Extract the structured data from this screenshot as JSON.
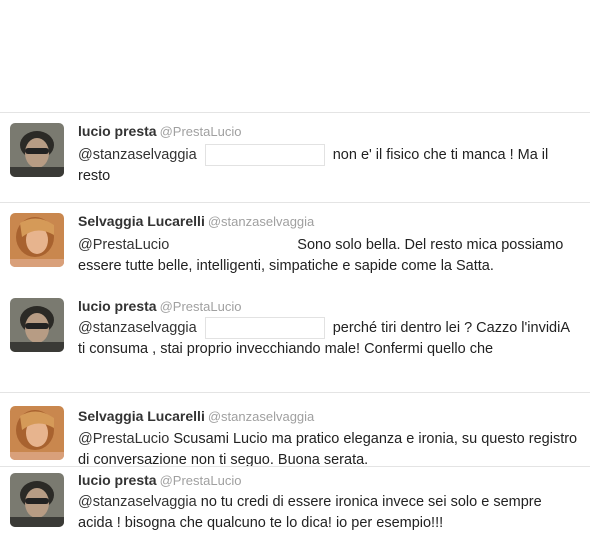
{
  "tweets": [
    {
      "name": "lucio presta",
      "handle": "@PrestaLucio",
      "mention": "@stanzaselvaggia",
      "text": "non e' il fisico che ti manca ! Ma il resto",
      "avatar": "lucio-avatar"
    },
    {
      "name": "Selvaggia Lucarelli",
      "handle": "@stanzaselvaggia",
      "mention": "@PrestaLucio",
      "text": "Sono solo bella. Del resto mica possiamo essere tutte belle, intelligenti, simpatiche e sapide come la Satta.",
      "avatar": "selvaggia-avatar"
    },
    {
      "name": "lucio presta",
      "handle": "@PrestaLucio",
      "mention": "@stanzaselvaggia",
      "text": "perché tiri dentro lei ? Cazzo l'invidiA ti consuma , stai proprio invecchiando male! Confermi quello che",
      "avatar": "lucio-avatar"
    },
    {
      "name": "Selvaggia Lucarelli",
      "handle": "@stanzaselvaggia",
      "mention": "@PrestaLucio",
      "text": "Scusami Lucio ma pratico eleganza e ironia, su questo registro di conversazione non ti seguo. Buona serata.",
      "avatar": "selvaggia-avatar"
    },
    {
      "name": "lucio presta",
      "handle": "@PrestaLucio",
      "mention": "@stanzaselvaggia",
      "text": "no tu credi di essere ironica invece sei solo e sempre acida ! bisogna che qualcuno te lo dica! io per esempio!!!",
      "avatar": "lucio-avatar"
    }
  ]
}
